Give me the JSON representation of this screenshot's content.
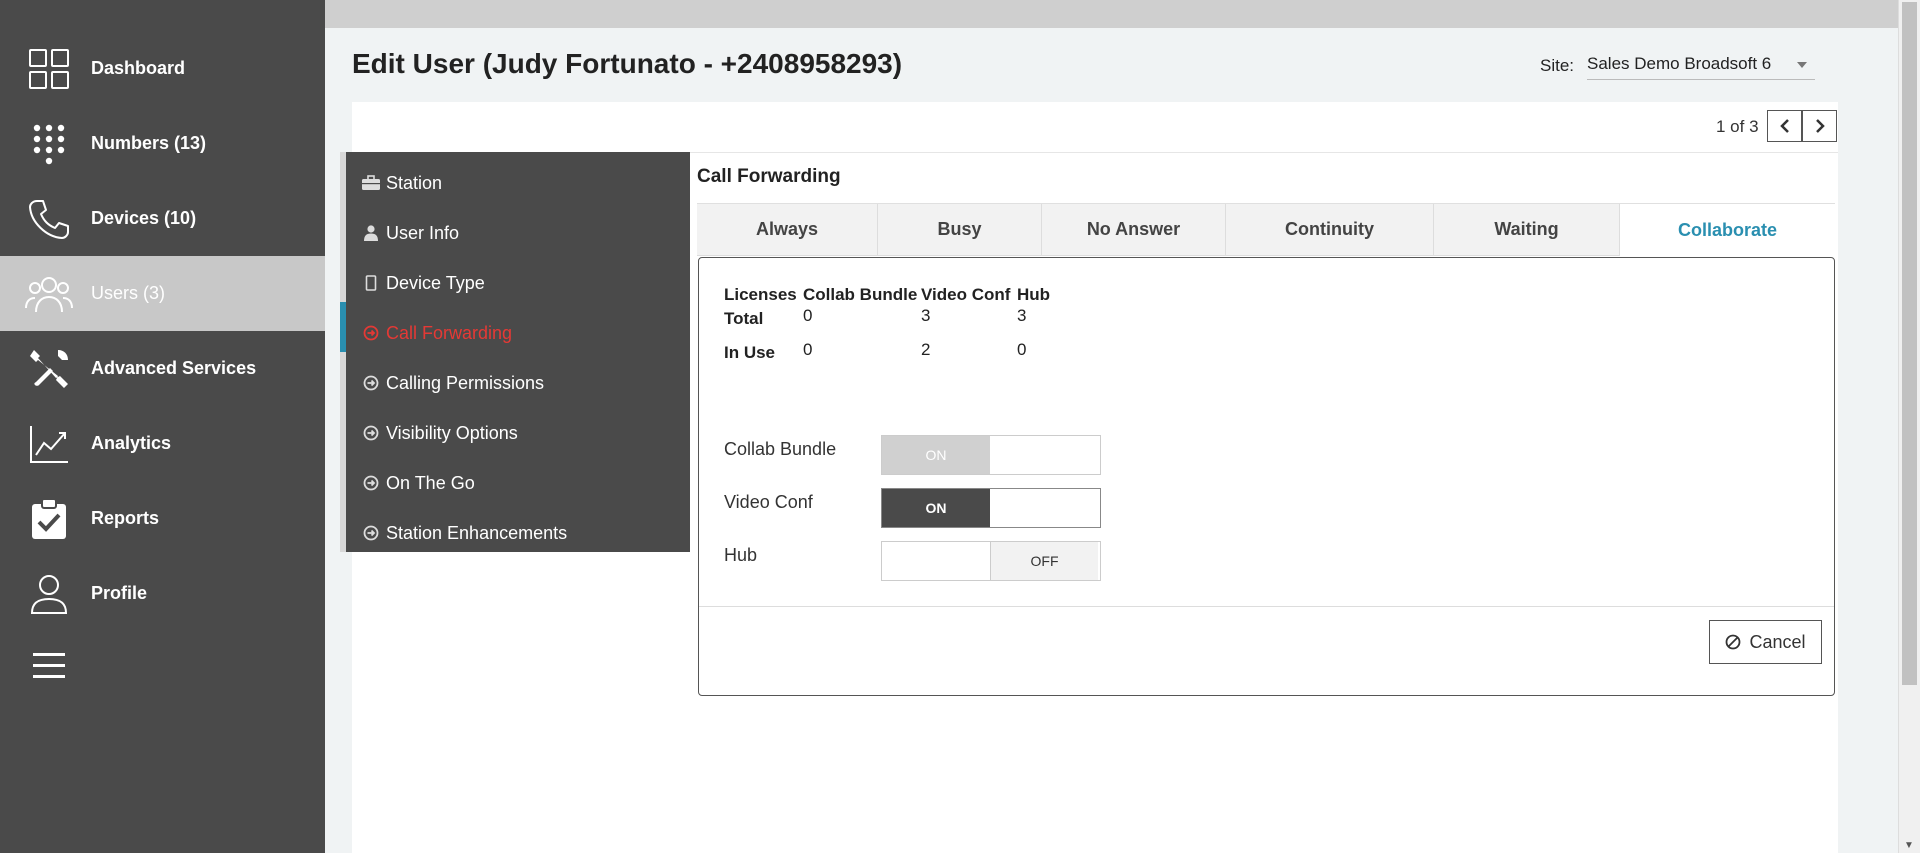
{
  "sidebar": {
    "items": [
      {
        "label": "Dashboard",
        "icon": "dashboard-grid-icon"
      },
      {
        "label": "Numbers (13)",
        "icon": "keypad-icon"
      },
      {
        "label": "Devices (10)",
        "icon": "phone-icon"
      },
      {
        "label": "Users (3)",
        "icon": "users-icon",
        "active": true
      },
      {
        "label": "Advanced Services",
        "icon": "tools-icon"
      },
      {
        "label": "Analytics",
        "icon": "analytics-chart-icon"
      },
      {
        "label": "Reports",
        "icon": "clipboard-check-icon"
      },
      {
        "label": "Profile",
        "icon": "profile-icon"
      }
    ],
    "menu_icon": "hamburger-menu-icon"
  },
  "header": {
    "title": "Edit User (Judy Fortunato - +2408958293)",
    "site_label": "Site:",
    "site_value": "Sales Demo Broadsoft 6"
  },
  "pager": {
    "text": "1 of 3"
  },
  "left_menu": {
    "items": [
      {
        "label": "Station",
        "icon": "briefcase-icon"
      },
      {
        "label": "User Info",
        "icon": "person-icon"
      },
      {
        "label": "Device Type",
        "icon": "device-icon"
      },
      {
        "label": "Call Forwarding",
        "icon": "arrow-circle-icon",
        "active": true
      },
      {
        "label": "Calling Permissions",
        "icon": "arrow-circle-icon"
      },
      {
        "label": "Visibility Options",
        "icon": "arrow-circle-icon"
      },
      {
        "label": "On The Go",
        "icon": "arrow-circle-icon"
      },
      {
        "label": "Station Enhancements",
        "icon": "arrow-circle-icon"
      }
    ]
  },
  "call_forwarding": {
    "title": "Call Forwarding",
    "tabs": [
      "Always",
      "Busy",
      "No Answer",
      "Continuity",
      "Waiting",
      "Collaborate"
    ],
    "active_tab": "Collaborate",
    "licenses": {
      "headers": [
        "Licenses",
        "Collab Bundle",
        "Video Conf",
        "Hub"
      ],
      "rows": [
        {
          "label": "Total",
          "values": [
            "0",
            "3",
            "3"
          ]
        },
        {
          "label": "In Use",
          "values": [
            "0",
            "2",
            "0"
          ]
        }
      ]
    },
    "toggles": [
      {
        "label": "Collab Bundle",
        "text": "ON",
        "state": "on-disabled"
      },
      {
        "label": "Video Conf",
        "text": "ON",
        "state": "on"
      },
      {
        "label": "Hub",
        "text": "OFF",
        "state": "off"
      }
    ],
    "cancel_label": "Cancel"
  },
  "colors": {
    "sidebar_bg": "#4a4a4a",
    "active_tab": "#2a8fb0",
    "active_menu": "#e53935"
  }
}
